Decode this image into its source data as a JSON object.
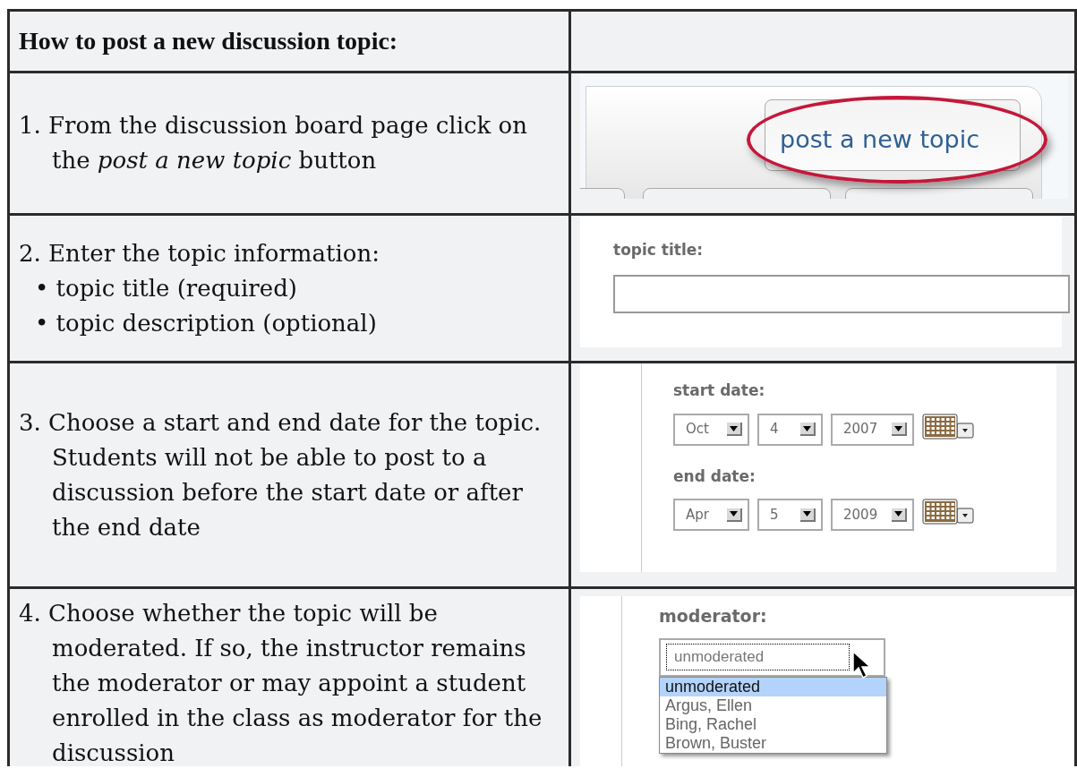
{
  "heading": "How to post a new discussion topic:",
  "steps": [
    {
      "kind": "button",
      "lines": [
        "1. From the discussion board page click on the *post a new topic* button"
      ],
      "button_label": "post a new topic"
    },
    {
      "kind": "field",
      "lines": [
        "2. Enter the topic information:",
        "• topic title (required)",
        "• topic description (optional)"
      ],
      "field_label": "topic title:"
    },
    {
      "kind": "dates",
      "lines": [
        "3. Choose a start and end date for the topic. Students will not be able to post to a discussion before the start date or after the end date"
      ],
      "dates": [
        {
          "label": "start date:",
          "month": "Oct",
          "day": "4",
          "year": "2007"
        },
        {
          "label": "end date:",
          "month": "Apr",
          "day": "5",
          "year": "2009"
        }
      ]
    },
    {
      "kind": "dropdown",
      "lines": [
        "4. Choose whether the topic will be moderated. If so, the instructor remains the moderator or may appoint a student enrolled in the class as moderator for the discussion"
      ],
      "dropdown_label": "moderator:",
      "value": "unmoderated",
      "options": [
        {
          "text": "unmoderated",
          "selected": true
        },
        {
          "text": "Argus, Ellen",
          "selected": false
        },
        {
          "text": "Bing, Rachel",
          "selected": false
        },
        {
          "text": "Brown, Buster",
          "selected": false
        }
      ]
    }
  ]
}
